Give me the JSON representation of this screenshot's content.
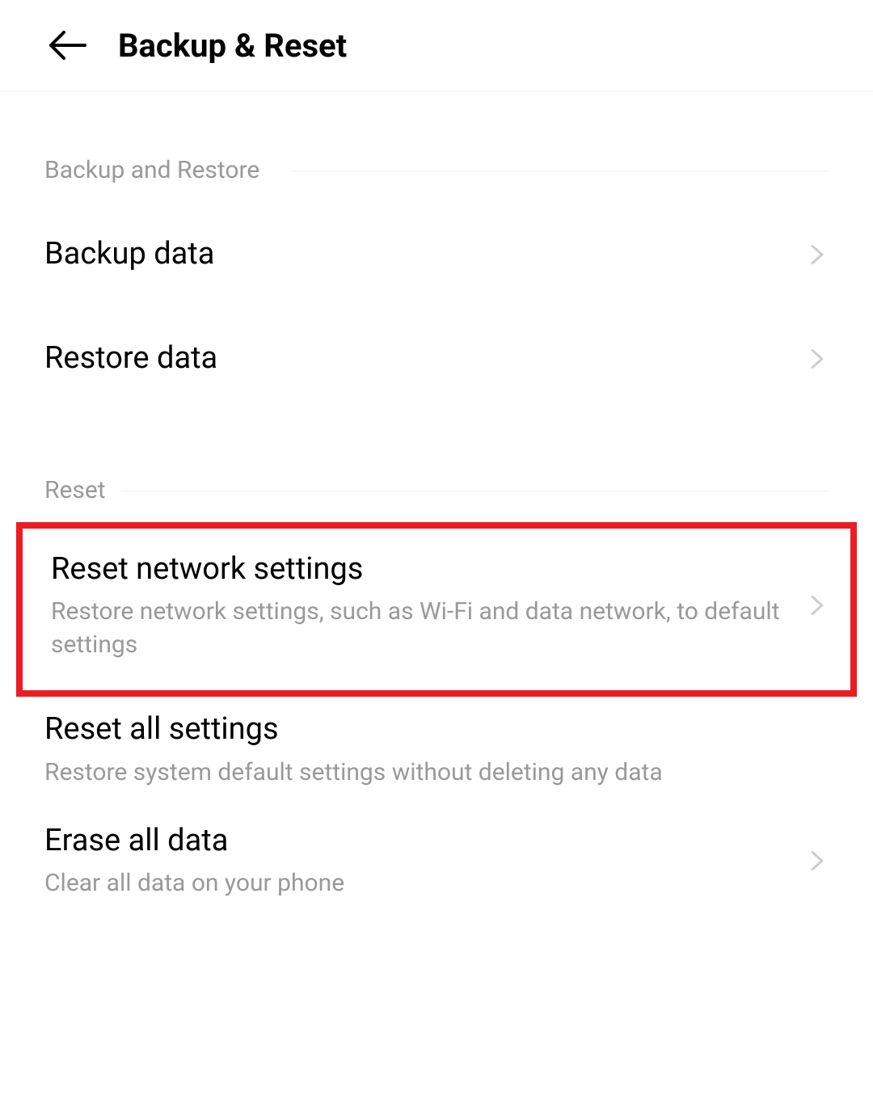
{
  "header": {
    "title": "Backup & Reset"
  },
  "sections": {
    "backup": {
      "header": "Backup and Restore",
      "items": [
        {
          "title": "Backup data"
        },
        {
          "title": "Restore data"
        }
      ]
    },
    "reset": {
      "header": "Reset",
      "items": [
        {
          "title": "Reset network settings",
          "subtitle": "Restore network settings, such as Wi-Fi and data network, to default settings"
        },
        {
          "title": "Reset all settings",
          "subtitle": "Restore system default settings without deleting any data"
        },
        {
          "title": "Erase all data",
          "subtitle": "Clear all data on your phone"
        }
      ]
    }
  }
}
